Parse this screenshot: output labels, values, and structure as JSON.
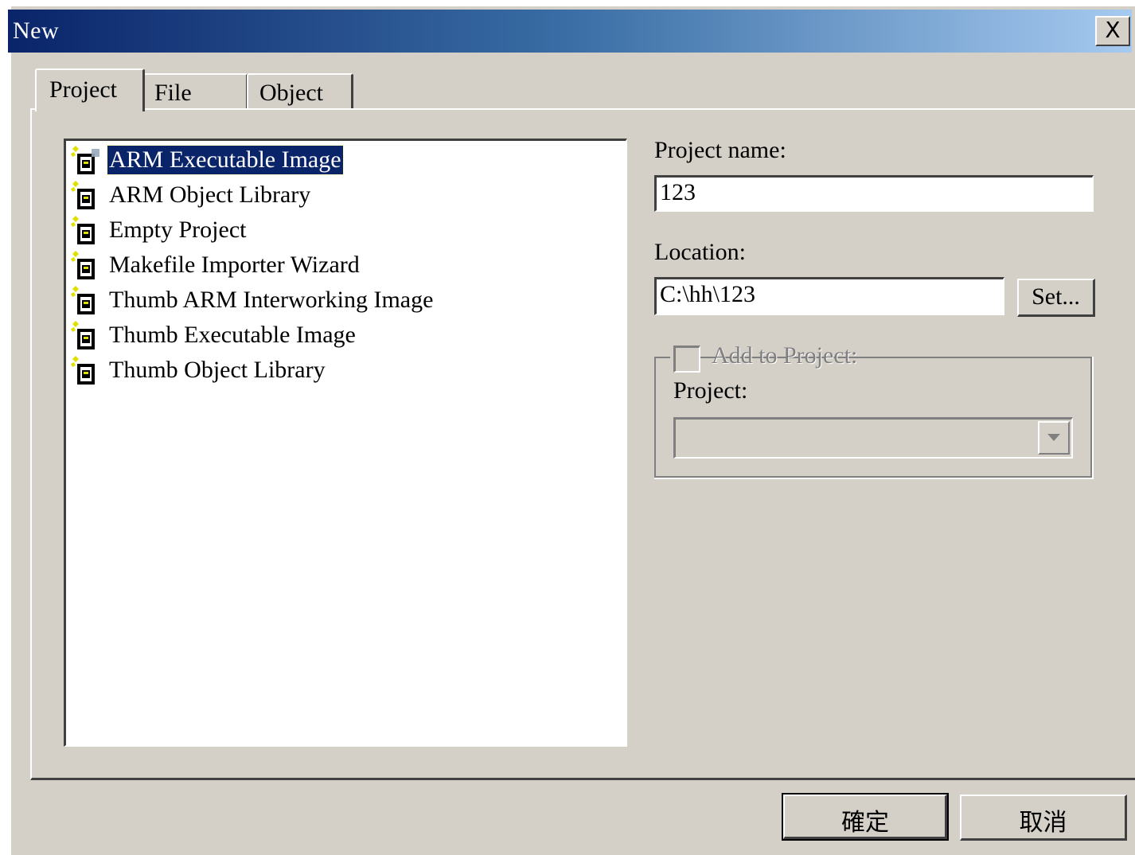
{
  "window": {
    "title": "New",
    "close_label": "X"
  },
  "tabs": [
    {
      "label": "Project",
      "active": true
    },
    {
      "label": "File",
      "active": false
    },
    {
      "label": "Object",
      "active": false
    }
  ],
  "project_types": [
    {
      "label": "ARM Executable Image",
      "selected": true,
      "icon": "project-wizard-icon"
    },
    {
      "label": "ARM Object Library",
      "selected": false,
      "icon": "project-wizard-icon"
    },
    {
      "label": "Empty Project",
      "selected": false,
      "icon": "project-wizard-icon"
    },
    {
      "label": "Makefile Importer Wizard",
      "selected": false,
      "icon": "project-wizard-icon"
    },
    {
      "label": "Thumb ARM Interworking Image",
      "selected": false,
      "icon": "project-wizard-icon"
    },
    {
      "label": "Thumb Executable Image",
      "selected": false,
      "icon": "project-wizard-icon"
    },
    {
      "label": "Thumb Object Library",
      "selected": false,
      "icon": "project-wizard-icon"
    }
  ],
  "form": {
    "project_name_label": "Project name:",
    "project_name_value": "123",
    "location_label": "Location:",
    "location_value": "C:\\hh\\123",
    "set_button": "Set...",
    "add_to_project_label": "Add to Project:",
    "add_to_project_checked": false,
    "project_label": "Project:",
    "project_value": ""
  },
  "buttons": {
    "ok": "確定",
    "cancel": "取消"
  },
  "colors": {
    "dialog_bg": "#d4d0c8",
    "title_start": "#0a246a",
    "title_end": "#a6caf0",
    "selection": "#0a246a"
  }
}
